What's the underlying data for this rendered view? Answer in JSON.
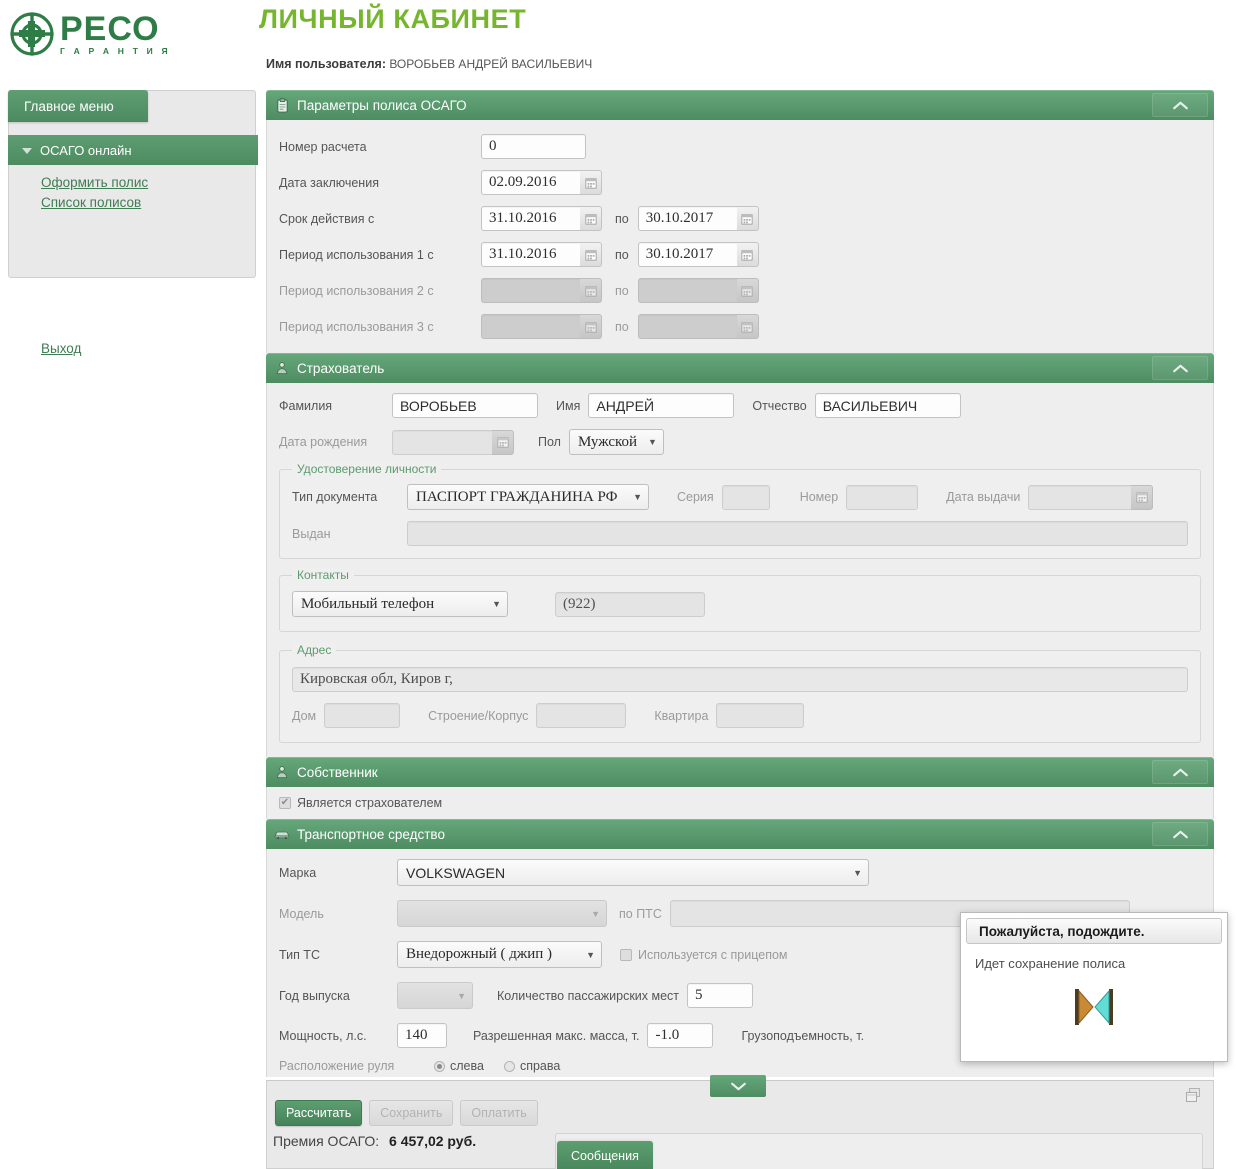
{
  "brand": {
    "logo_name": "РЕСО",
    "logo_sub": "Г А Р А Н Т И Я",
    "accent_green": "#2f7d46",
    "title_green": "#76b62e",
    "panel_green": "#4e8c62"
  },
  "header": {
    "title": "ЛИЧНЫЙ КАБИНЕТ",
    "username_label": "Имя пользователя:",
    "username_value": "ВОРОБЬЕВ АНДРЕЙ ВАСИЛЬЕВИЧ"
  },
  "sidebar": {
    "main_menu_label": "Главное меню",
    "group_label": "ОСАГО онлайн",
    "links": [
      {
        "label": "Оформить полис"
      },
      {
        "label": "Список полисов"
      }
    ],
    "logout_label": "Выход"
  },
  "policy_params": {
    "header": "Параметры полиса ОСАГО",
    "icon": "clipboard-icon",
    "calc_number_label": "Номер расчета",
    "calc_number_value": "0",
    "conclusion_date_label": "Дата заключения",
    "conclusion_date_value": "02.09.2016",
    "validity_label": "Срок действия с",
    "validity_from": "31.10.2016",
    "to_label": "по",
    "validity_to": "30.10.2017",
    "period1_label": "Период использования 1 с",
    "period1_from": "31.10.2016",
    "period1_to": "30.10.2017",
    "period2_label": "Период использования 2 с",
    "period2_from": "",
    "period2_to": "",
    "period3_label": "Период использования 3 с",
    "period3_from": "",
    "period3_to": ""
  },
  "insurer": {
    "header": "Страхователь",
    "icon": "person-icon",
    "surname_label": "Фамилия",
    "surname_value": "ВОРОБЬЕВ",
    "firstname_label": "Имя",
    "firstname_value": "АНДРЕЙ",
    "patronymic_label": "Отчество",
    "patronymic_value": "ВАСИЛЬЕВИЧ",
    "birthdate_label": "Дата рождения",
    "birthdate_value": "",
    "gender_label": "Пол",
    "gender_value": "Мужской",
    "identity": {
      "legend": "Удостоверение личности",
      "doctype_label": "Тип документа",
      "doctype_value": "ПАСПОРТ ГРАЖДАНИНА РФ",
      "series_label": "Серия",
      "series_value": "",
      "number_label": "Номер",
      "number_value": "",
      "issue_date_label": "Дата выдачи",
      "issue_date_value": "",
      "issued_by_label": "Выдан",
      "issued_by_value": ""
    },
    "contacts": {
      "legend": "Контакты",
      "type_value": "Мобильный телефон",
      "phone_value": "(922)"
    },
    "address": {
      "legend": "Адрес",
      "address_value": "Кировская обл, Киров г,",
      "house_label": "Дом",
      "house_value": "",
      "building_label": "Строение/Корпус",
      "building_value": "",
      "flat_label": "Квартира",
      "flat_value": ""
    }
  },
  "owner": {
    "header": "Собственник",
    "icon": "person-icon",
    "same_as_insurer_label": "Является страхователем",
    "same_as_insurer_checked": true
  },
  "vehicle": {
    "header": "Транспортное средство",
    "icon": "car-icon",
    "brand_label": "Марка",
    "brand_value": "VOLKSWAGEN",
    "model_label": "Модель",
    "model_value": "",
    "pts_label": "по ПТС",
    "pts_value": "",
    "type_label": "Тип ТС",
    "type_value": "Внедорожный ( джип )",
    "trailer_label": "Используется с прицепом",
    "trailer_checked": false,
    "year_label": "Год выпуска",
    "year_value": "",
    "seats_label": "Количество пассажирских мест",
    "seats_value": "5",
    "power_label": "Мощность, л.с.",
    "power_value": "140",
    "max_mass_label": "Разрешенная макс. масса, т.",
    "max_mass_value": "-1.0",
    "load_capacity_label": "Грузоподъемность, т.",
    "wheel_label": "Расположение руля",
    "wheel_left": "слева",
    "wheel_right": "справа",
    "wheel_selected": "слева"
  },
  "bottom": {
    "calculate_label": "Рассчитать",
    "save_label": "Сохранить",
    "pay_label": "Оплатить",
    "premium_label": "Премия ОСАГО:",
    "premium_value": "6 457,02 руб.",
    "messages_tab_label": "Сообщения"
  },
  "modal": {
    "title": "Пожалуйста, подождите.",
    "body": "Идет сохранение полиса",
    "spinner_icon": "hourglass-icon"
  }
}
